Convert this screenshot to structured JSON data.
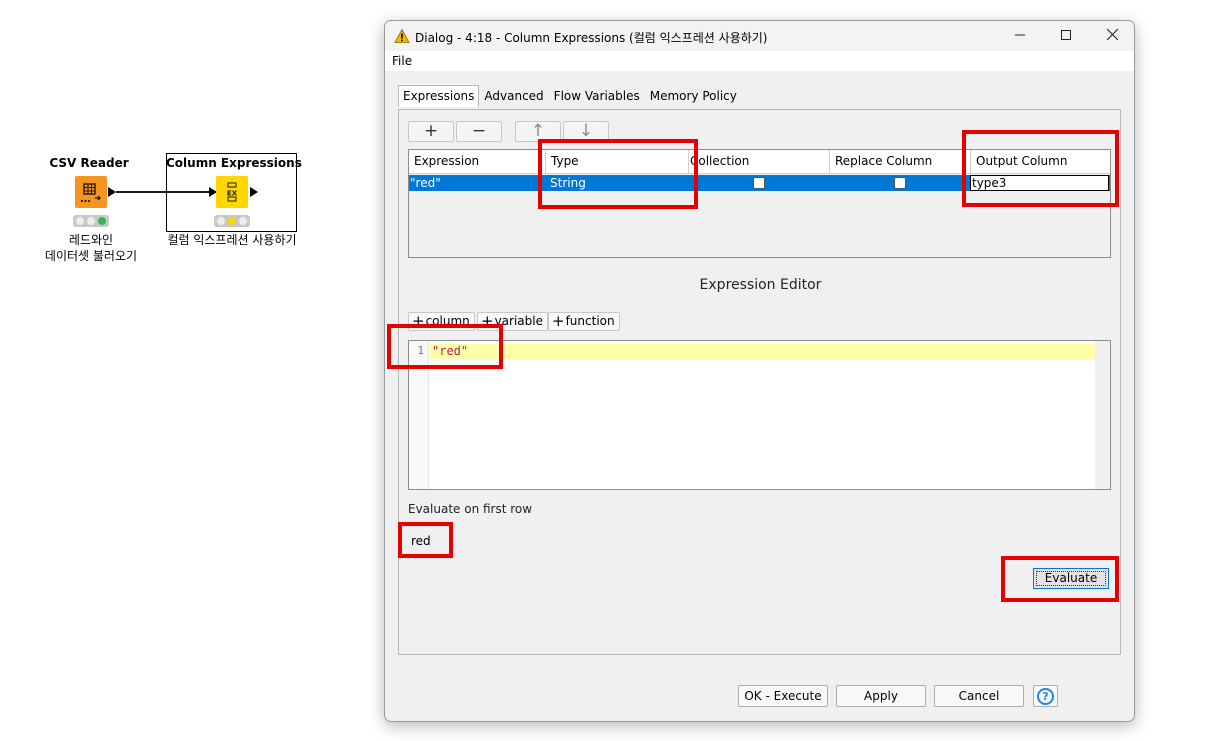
{
  "workflow": {
    "nodes": [
      {
        "title": "CSV Reader",
        "label_line1": "레드와인",
        "label_line2": "데이터셋 불러오기",
        "icon": "csv-reader-icon",
        "icon_color": "#f7941d",
        "status": "executed"
      },
      {
        "title": "Column Expressions",
        "label_line1": "컬럼 익스프레션 사용하기",
        "icon": "column-expressions-icon",
        "icon_color": "#ffd700",
        "status": "configured"
      }
    ]
  },
  "dialog": {
    "title": "Dialog - 4:18 - Column Expressions (컬럼 익스프레션 사용하기)",
    "title_icon": "warning-triangle-icon",
    "menu": {
      "file": "File"
    },
    "tabs": [
      {
        "label": "Expressions",
        "active": true
      },
      {
        "label": "Advanced"
      },
      {
        "label": "Flow Variables"
      },
      {
        "label": "Memory Policy"
      }
    ],
    "toolbar": {
      "add": "+",
      "remove": "−",
      "up": "↑",
      "down": "↓"
    },
    "table": {
      "columns": [
        "Expression",
        "Type",
        "Collection",
        "Replace Column",
        "Output Column"
      ],
      "rows": [
        {
          "expression": "\"red\"",
          "type": "String",
          "collection": false,
          "replace_column": false,
          "output_column": "type3"
        }
      ]
    },
    "editor": {
      "title": "Expression Editor",
      "insert_buttons": [
        "column",
        "variable",
        "function"
      ],
      "lines": [
        {
          "number": "1",
          "code": "\"red\""
        }
      ]
    },
    "evaluate": {
      "label": "Evaluate on first row",
      "result": "red",
      "button": "Evaluate"
    },
    "footer": {
      "ok_execute": "OK - Execute",
      "apply": "Apply",
      "cancel": "Cancel",
      "help_icon": "help-icon"
    }
  },
  "colors": {
    "selection": "#0078d7",
    "highlight_box": "#e60000",
    "current_line": "#ffffaa",
    "string_literal": "#c2185b"
  }
}
